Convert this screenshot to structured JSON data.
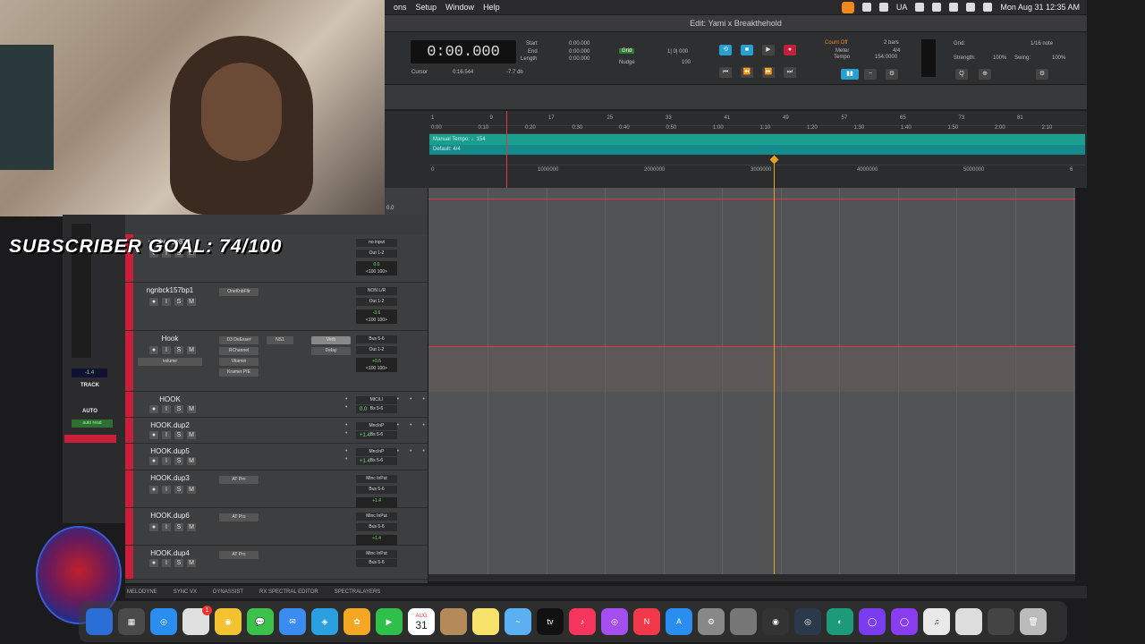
{
  "menubar": {
    "items": [
      "ons",
      "Setup",
      "Window",
      "Help"
    ],
    "clock": "Mon Aug 31  12:35 AM",
    "input": "UA"
  },
  "window": {
    "title": "Edit: Yami x Breakthehold"
  },
  "transport": {
    "main_counter": "0:00.000",
    "start_label": "Start",
    "end_label": "End",
    "length_label": "Length",
    "start": "0:00.000",
    "end": "0:00.000",
    "length": "0:00.000",
    "cursor_label": "Cursor",
    "cursor": "0:16.544",
    "level": "-7.7 db",
    "grid_label": "Grid",
    "grid_value": "1| 0| 000",
    "nudge_label": "Nudge",
    "nudge_value": "100",
    "count_off": "Count Off",
    "meter_label": "Meter",
    "tempo_label": "Tempo",
    "bars": "2 bars",
    "meter_value": "4/4",
    "tempo_value": "154.0000",
    "grid2_label": "Grid:",
    "grid2_value": "1/16 note",
    "strength_label": "Strength:",
    "strength": "100%",
    "swing_label": "Swing:",
    "swing": "100%"
  },
  "ruler": {
    "bars": [
      "1",
      "9",
      "17",
      "25",
      "33",
      "41",
      "49",
      "57",
      "65",
      "73",
      "81"
    ],
    "mins": [
      "0:00",
      "0:10",
      "0:20",
      "0:30",
      "0:40",
      "0:50",
      "1:00",
      "1:10",
      "1:20",
      "1:30",
      "1:40",
      "1:50",
      "2:00",
      "2:10"
    ],
    "samples": [
      "0",
      "1000000",
      "2000000",
      "3000000",
      "4000000",
      "5000000",
      "6"
    ],
    "tempo_text": "Manual Tempo: ♩154",
    "meter_text": "Default: 4/4"
  },
  "overlay": {
    "subscriber": "SUBSCRIBER GOAL: 74/100"
  },
  "left_meters": {
    "value": "-1.4",
    "track_label": "TRACK",
    "auto_label": "AUTO",
    "auto_value": "auto read"
  },
  "tracks": [
    {
      "name": "wtchgnbc8TL",
      "inserts": [],
      "input": "no input",
      "out": "Out 1-2",
      "vol": "0.0",
      "pan": "<100   100>"
    },
    {
      "name": "ngnbck157bp1",
      "inserts": [
        "OneKnbFltr"
      ],
      "input": "NON L/R",
      "out": "Out 1-2",
      "vol": "-3.6",
      "pan": "<100   100>"
    },
    {
      "name": "Hook",
      "inserts": [
        "D3 DeEsser",
        "RChannel",
        "Vitamin",
        "Kramer PIE"
      ],
      "inserts2": [
        "NS1"
      ],
      "sends": [
        "Verb",
        "Delay"
      ],
      "input": "Bus 5-6",
      "out": "Out 1-2",
      "vol": "+0.6",
      "pan": "<100   100>",
      "volume_label": "volume"
    },
    {
      "name": "HOOK",
      "input": "MIC/LI",
      "out": "Bs 5-6",
      "vol": "0.0"
    },
    {
      "name": "HOOK.dup2",
      "input": "MncInP",
      "out": "Bs 5-6",
      "vol": "+1.4"
    },
    {
      "name": "HOOK.dup5",
      "input": "MncInP",
      "out": "Bs 5-6",
      "vol": "+1.4"
    },
    {
      "name": "HOOK.dup3",
      "inserts": [
        "AT Pro"
      ],
      "input": "Minc InPut",
      "out": "Bus 5-6",
      "vol": "+1.4"
    },
    {
      "name": "HOOK.dup6",
      "inserts": [
        "AT Pro"
      ],
      "input": "Minc InPut",
      "out": "Bus 5-6",
      "vol": "+1.4"
    },
    {
      "name": "HOOK.dup4",
      "inserts": [
        "AT Pro"
      ],
      "input": "Minc InPut",
      "out": "Bus 5-6",
      "vol": ""
    }
  ],
  "bottombar": {
    "items": [
      "MELODYNE",
      "SYNC VX",
      "DYNASSIST",
      "RX SPECTRAL EDITOR",
      "SPECTRALAYERS"
    ]
  },
  "dock": {
    "calendar_month": "AUG",
    "calendar_day": "31",
    "badge": "1"
  }
}
